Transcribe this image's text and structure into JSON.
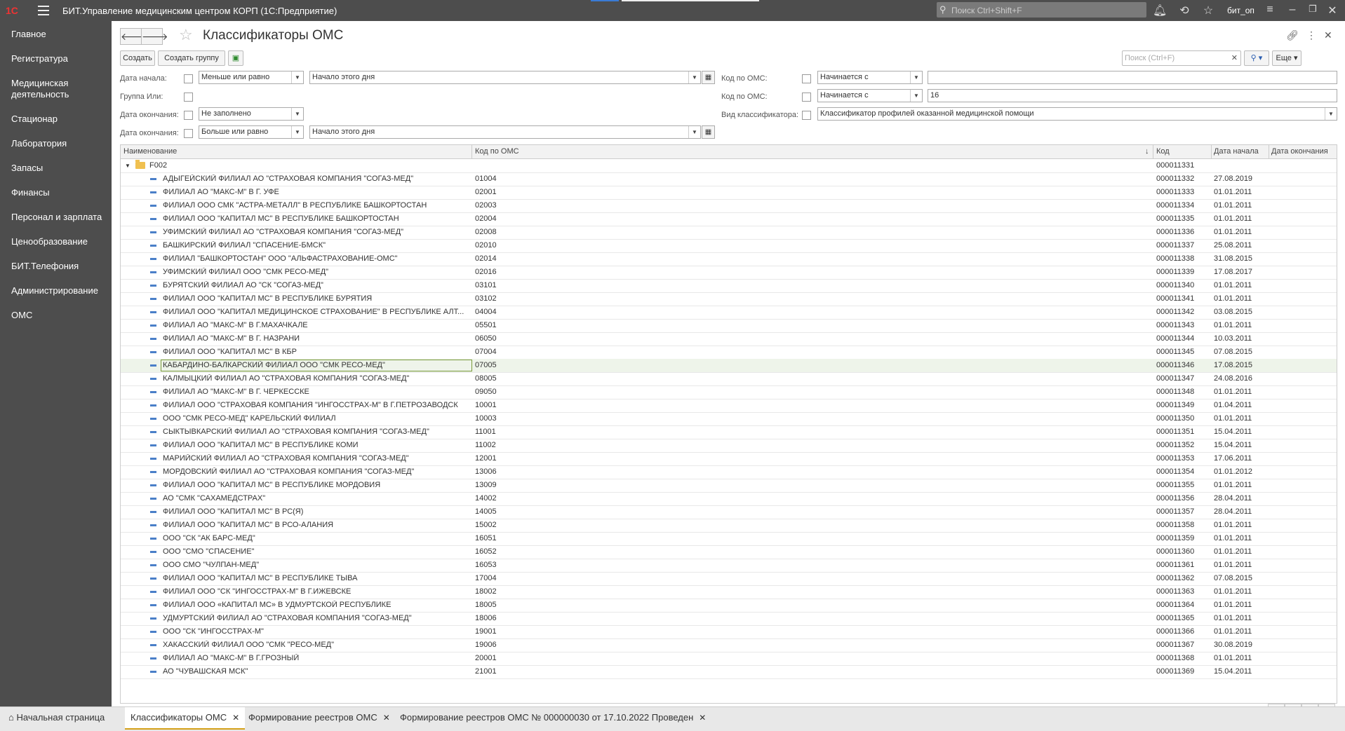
{
  "app": {
    "title": "БИТ.Управление медицинским центром КОРП (1С:Предприятие)",
    "search_placeholder": "Поиск Ctrl+Shift+F",
    "user": "бит_оп"
  },
  "sidebar": {
    "items": [
      "Главное",
      "Регистратура",
      "Медицинская деятельность",
      "Стационар",
      "Лаборатория",
      "Запасы",
      "Финансы",
      "Персонал и зарплата",
      "Ценообразование",
      "БИТ.Телефония",
      "Администрирование",
      "ОМС"
    ]
  },
  "page": {
    "title": "Классификаторы ОМС"
  },
  "toolbar": {
    "create": "Создать",
    "create_group": "Создать группу",
    "search_placeholder": "Поиск (Ctrl+F)",
    "more": "Еще"
  },
  "filters": {
    "date_start": {
      "label": "Дата начала:",
      "cond": "Меньше или равно",
      "value": "Начало этого дня"
    },
    "group_or": {
      "label": "Группа Или:"
    },
    "date_end1": {
      "label": "Дата окончания:",
      "cond": "Не заполнено"
    },
    "date_end2": {
      "label": "Дата окончания:",
      "cond": "Больше или равно",
      "value": "Начало этого дня"
    },
    "code1": {
      "label": "Код по ОМС:",
      "cond": "Начинается с",
      "value": ""
    },
    "code2": {
      "label": "Код по ОМС:",
      "cond": "Начинается с",
      "value": "16"
    },
    "kind": {
      "label": "Вид классификатора:",
      "value": "Классификатор профилей оказанной медицинской помощи"
    }
  },
  "table": {
    "columns": [
      "Наименование",
      "Код по ОМС",
      "Код",
      "Дата начала",
      "Дата окончания"
    ],
    "group": {
      "name": "F002",
      "code": "000011331"
    },
    "rows": [
      [
        "АДЫГЕЙСКИЙ ФИЛИАЛ АО \"СТРАХОВАЯ КОМПАНИЯ \"СОГАЗ-МЕД\"",
        "01004",
        "000011332",
        "27.08.2019",
        ""
      ],
      [
        "ФИЛИАЛ АО \"МАКС-М\" В Г. УФЕ",
        "02001",
        "000011333",
        "01.01.2011",
        ""
      ],
      [
        "ФИЛИАЛ ООО СМК \"АСТРА-МЕТАЛЛ\" В РЕСПУБЛИКЕ БАШКОРТОСТАН",
        "02003",
        "000011334",
        "01.01.2011",
        ""
      ],
      [
        "ФИЛИАЛ ООО \"КАПИТАЛ МС\" В РЕСПУБЛИКЕ БАШКОРТОСТАН",
        "02004",
        "000011335",
        "01.01.2011",
        ""
      ],
      [
        "УФИМСКИЙ ФИЛИАЛ АО \"СТРАХОВАЯ КОМПАНИЯ \"СОГАЗ-МЕД\"",
        "02008",
        "000011336",
        "01.01.2011",
        ""
      ],
      [
        "БАШКИРСКИЙ ФИЛИАЛ \"СПАСЕНИЕ-БМСК\"",
        "02010",
        "000011337",
        "25.08.2011",
        ""
      ],
      [
        "ФИЛИАЛ \"БАШКОРТОСТАН\" ООО \"АЛЬФАСТРАХОВАНИЕ-ОМС\"",
        "02014",
        "000011338",
        "31.08.2015",
        ""
      ],
      [
        "УФИМСКИЙ ФИЛИАЛ ООО \"СМК РЕСО-МЕД\"",
        "02016",
        "000011339",
        "17.08.2017",
        ""
      ],
      [
        "БУРЯТСКИЙ ФИЛИАЛ АО \"СК \"СОГАЗ-МЕД\"",
        "03101",
        "000011340",
        "01.01.2011",
        ""
      ],
      [
        "ФИЛИАЛ ООО \"КАПИТАЛ МС\" В РЕСПУБЛИКЕ БУРЯТИЯ",
        "03102",
        "000011341",
        "01.01.2011",
        ""
      ],
      [
        "ФИЛИАЛ ООО \"КАПИТАЛ МЕДИЦИНСКОЕ СТРАХОВАНИЕ\" В РЕСПУБЛИКЕ АЛТ...",
        "04004",
        "000011342",
        "03.08.2015",
        ""
      ],
      [
        "ФИЛИАЛ АО \"МАКС-М\" В Г.МАХАЧКАЛЕ",
        "05501",
        "000011343",
        "01.01.2011",
        ""
      ],
      [
        "ФИЛИАЛ АО \"МАКС-М\" В Г. НАЗРАНИ",
        "06050",
        "000011344",
        "10.03.2011",
        ""
      ],
      [
        "ФИЛИАЛ ООО \"КАПИТАЛ МС\" В КБР",
        "07004",
        "000011345",
        "07.08.2015",
        ""
      ],
      [
        "КАБАРДИНО-БАЛКАРСКИЙ ФИЛИАЛ ООО \"СМК РЕСО-МЕД\"",
        "07005",
        "000011346",
        "17.08.2015",
        ""
      ],
      [
        "КАЛМЫЦКИЙ ФИЛИАЛ АО \"СТРАХОВАЯ КОМПАНИЯ \"СОГАЗ-МЕД\"",
        "08005",
        "000011347",
        "24.08.2016",
        ""
      ],
      [
        "ФИЛИАЛ АО \"МАКС-М\" В Г. ЧЕРКЕССКЕ",
        "09050",
        "000011348",
        "01.01.2011",
        ""
      ],
      [
        "ФИЛИАЛ ООО \"СТРАХОВАЯ КОМПАНИЯ \"ИНГОССТРАХ-М\" В Г.ПЕТРОЗАВОДСК",
        "10001",
        "000011349",
        "01.04.2011",
        ""
      ],
      [
        "ООО \"СМК РЕСО-МЕД\" КАРЕЛЬСКИЙ ФИЛИАЛ",
        "10003",
        "000011350",
        "01.01.2011",
        ""
      ],
      [
        "СЫКТЫВКАРСКИЙ ФИЛИАЛ АО \"СТРАХОВАЯ КОМПАНИЯ \"СОГАЗ-МЕД\"",
        "11001",
        "000011351",
        "15.04.2011",
        ""
      ],
      [
        "ФИЛИАЛ ООО \"КАПИТАЛ МС\" В РЕСПУБЛИКЕ КОМИ",
        "11002",
        "000011352",
        "15.04.2011",
        ""
      ],
      [
        "МАРИЙСКИЙ ФИЛИАЛ АО \"СТРАХОВАЯ КОМПАНИЯ \"СОГАЗ-МЕД\"",
        "12001",
        "000011353",
        "17.06.2011",
        ""
      ],
      [
        "МОРДОВСКИЙ ФИЛИАЛ АО \"СТРАХОВАЯ КОМПАНИЯ \"СОГАЗ-МЕД\"",
        "13006",
        "000011354",
        "01.01.2012",
        ""
      ],
      [
        "ФИЛИАЛ ООО \"КАПИТАЛ МС\" В РЕСПУБЛИКЕ МОРДОВИЯ",
        "13009",
        "000011355",
        "01.01.2011",
        ""
      ],
      [
        "АО \"СМК \"САХАМЕДСТРАХ\"",
        "14002",
        "000011356",
        "28.04.2011",
        ""
      ],
      [
        "ФИЛИАЛ ООО \"КАПИТАЛ МС\" В РС(Я)",
        "14005",
        "000011357",
        "28.04.2011",
        ""
      ],
      [
        "ФИЛИАЛ ООО \"КАПИТАЛ МС\" В РСО-АЛАНИЯ",
        "15002",
        "000011358",
        "01.01.2011",
        ""
      ],
      [
        "ООО \"СК \"АК БАРС-МЕД\"",
        "16051",
        "000011359",
        "01.01.2011",
        ""
      ],
      [
        "ООО \"СМО \"СПАСЕНИЕ\"",
        "16052",
        "000011360",
        "01.01.2011",
        ""
      ],
      [
        "ООО СМО \"ЧУЛПАН-МЕД\"",
        "16053",
        "000011361",
        "01.01.2011",
        ""
      ],
      [
        "ФИЛИАЛ ООО \"КАПИТАЛ МС\" В РЕСПУБЛИКЕ ТЫВА",
        "17004",
        "000011362",
        "07.08.2015",
        ""
      ],
      [
        "ФИЛИАЛ ООО \"СК \"ИНГОССТРАХ-М\" В Г.ИЖЕВСКЕ",
        "18002",
        "000011363",
        "01.01.2011",
        ""
      ],
      [
        "ФИЛИАЛ ООО «КАПИТАЛ МС» В УДМУРТСКОЙ РЕСПУБЛИКЕ",
        "18005",
        "000011364",
        "01.01.2011",
        ""
      ],
      [
        "УДМУРТСКИЙ ФИЛИАЛ АО \"СТРАХОВАЯ КОМПАНИЯ \"СОГАЗ-МЕД\"",
        "18006",
        "000011365",
        "01.01.2011",
        ""
      ],
      [
        "ООО \"СК \"ИНГОССТРАХ-М\"",
        "19001",
        "000011366",
        "01.01.2011",
        ""
      ],
      [
        "ХАКАССКИЙ ФИЛИАЛ ООО \"СМК \"РЕСО-МЕД\"",
        "19006",
        "000011367",
        "30.08.2019",
        ""
      ],
      [
        "ФИЛИАЛ АО \"МАКС-М\" В Г.ГРОЗНЫЙ",
        "20001",
        "000011368",
        "01.01.2011",
        ""
      ],
      [
        "АО \"ЧУВАШСКАЯ МСК\"",
        "21001",
        "000011369",
        "15.04.2011",
        ""
      ]
    ],
    "selected_index": 14
  },
  "tabs": [
    {
      "label": "Начальная страница",
      "active": false
    },
    {
      "label": "Классификаторы ОМС",
      "active": true
    },
    {
      "label": "Формирование реестров ОМС",
      "active": false
    },
    {
      "label": "Формирование реестров ОМС № 000000030 от 17.10.2022 Проведен",
      "active": false
    }
  ]
}
